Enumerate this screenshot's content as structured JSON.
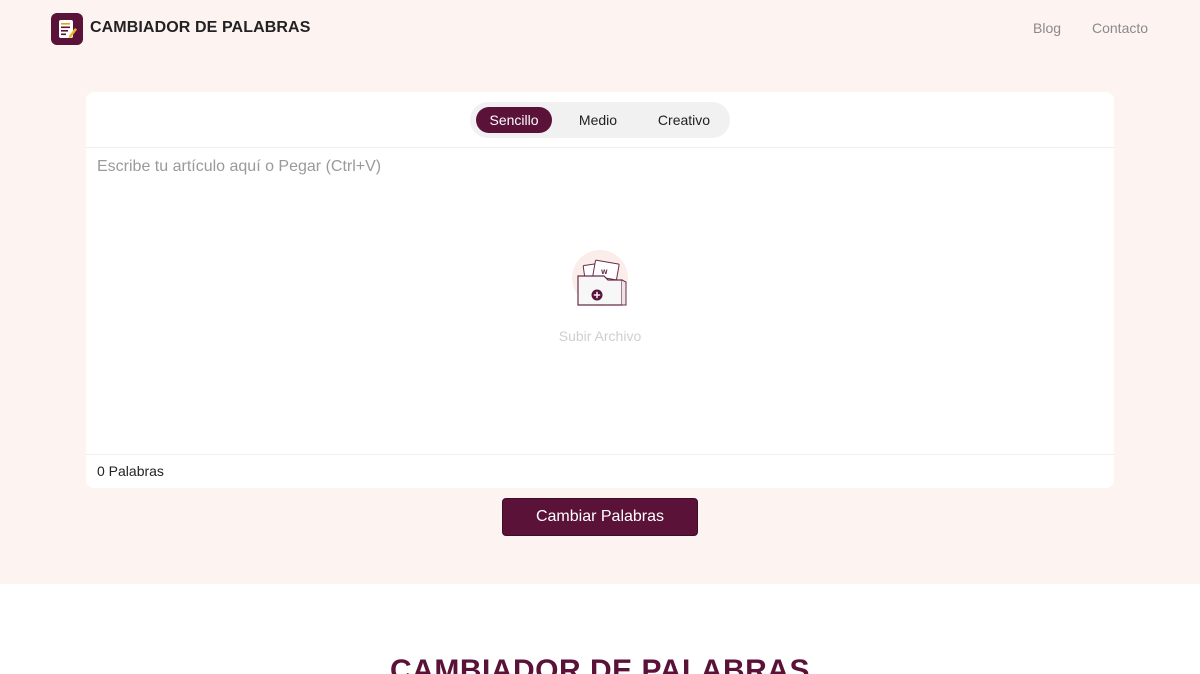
{
  "header": {
    "brand": "CAMBIADOR DE PALABRAS",
    "nav": {
      "blog": "Blog",
      "contact": "Contacto"
    }
  },
  "modes": [
    "Sencillo",
    "Medio",
    "Creativo"
  ],
  "selected_mode": "Sencillo",
  "editor": {
    "value": "",
    "placeholder": "Escribe tu artículo aquí o Pegar (Ctrl+V)",
    "upload_label": "Subir Archivo",
    "word_count": "0 Palabras"
  },
  "cta": {
    "label": "Cambiar Palabras"
  },
  "section": {
    "title": "CAMBIADOR DE PALABRAS"
  },
  "colors": {
    "brand": "#5a1238",
    "hero_bg": "#fdf4f2",
    "card_bg": "#ffffff"
  },
  "icons": {
    "logo": "notepad-pencil-icon",
    "upload": "folder-documents-add-icon"
  }
}
